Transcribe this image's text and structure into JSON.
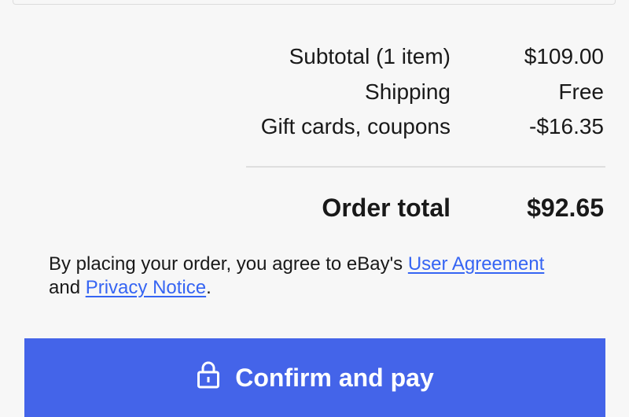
{
  "summary": {
    "rows": [
      {
        "label": "Subtotal (1 item)",
        "value": "$109.00"
      },
      {
        "label": "Shipping",
        "value": "Free"
      },
      {
        "label": "Gift cards, coupons",
        "value": "-$16.35"
      }
    ],
    "total_label": "Order total",
    "total_value": "$92.65"
  },
  "legal": {
    "text_before": "By placing your order, you agree to eBay's ",
    "user_agreement_link": "User Agreement",
    "text_middle": "and ",
    "privacy_link": "Privacy Notice",
    "text_after": "."
  },
  "button": {
    "label": "Confirm and pay",
    "icon": "lock-icon"
  },
  "colors": {
    "background": "#f7f7f7",
    "button": "#4464e9",
    "link": "#3665f3",
    "text": "#191919"
  }
}
